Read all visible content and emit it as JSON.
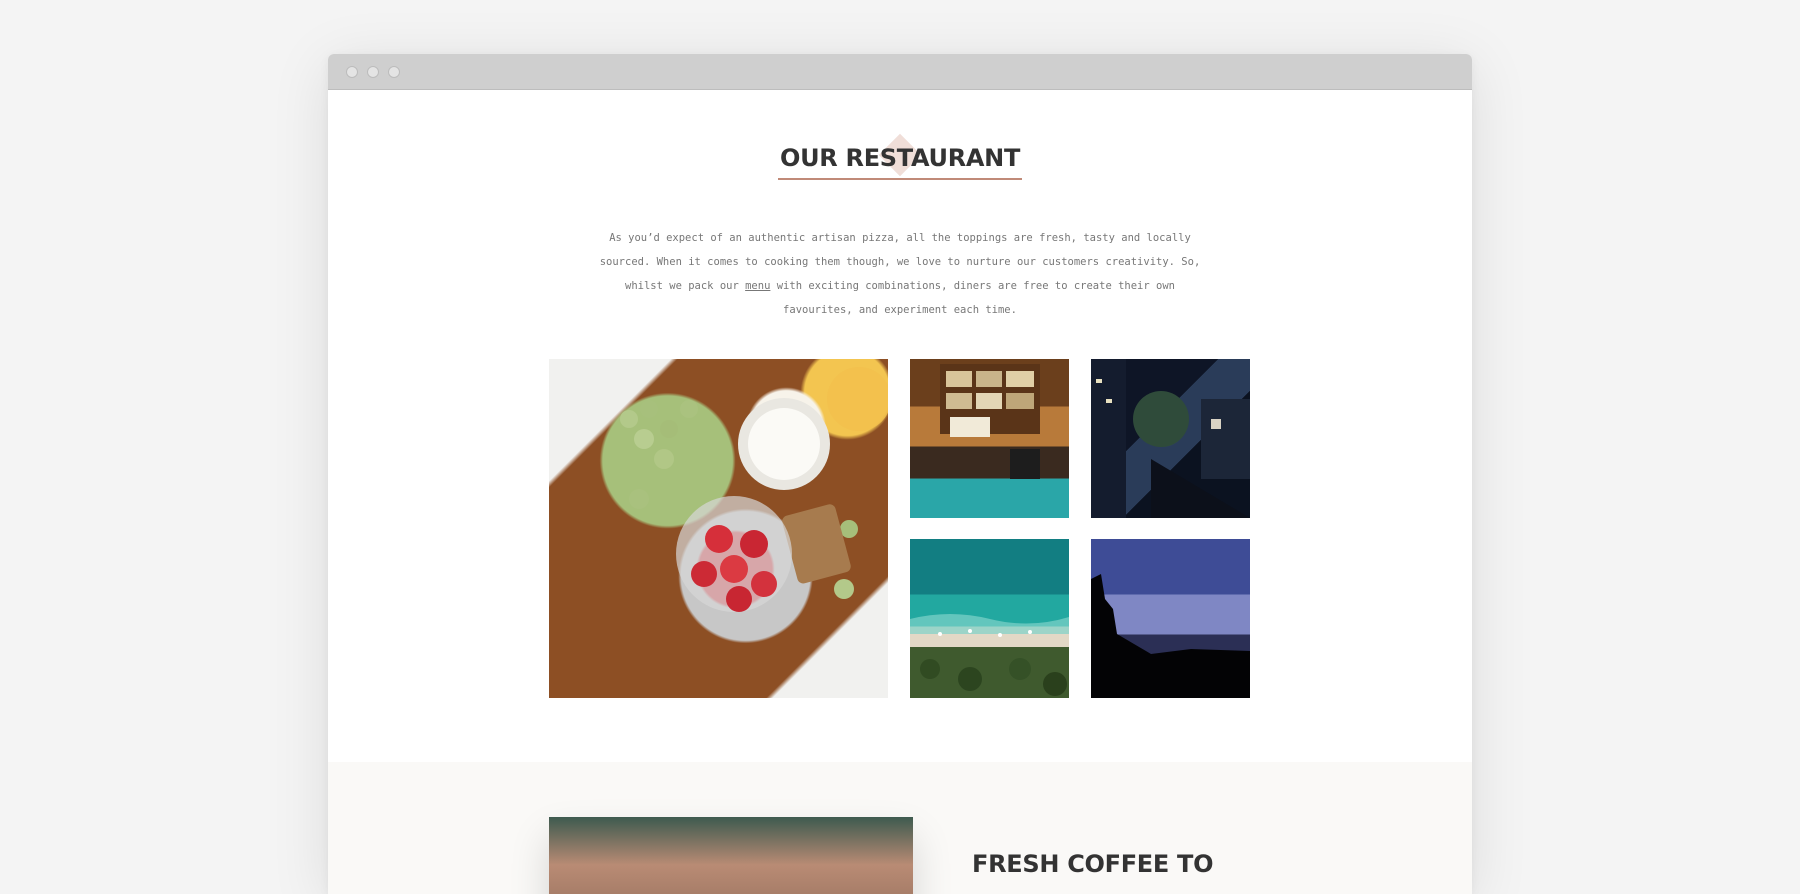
{
  "section": {
    "title": "OUR RESTAURANT",
    "intro_before": "As you’d expect of an authentic artisan pizza, all the toppings are fresh, tasty and locally sourced. When it comes to cooking them though, we love to nurture our customers creativity. So, whilst we pack our ",
    "intro_link": "menu",
    "intro_after": " with exciting combinations, diners are free to create their own favourites, and experiment each time."
  },
  "next_section": {
    "title": "FRESH COFFEE TO"
  },
  "colors": {
    "accent": "#c08a78",
    "diamond": "#f0ded8",
    "title_text": "#333333",
    "body_text": "#777777"
  }
}
